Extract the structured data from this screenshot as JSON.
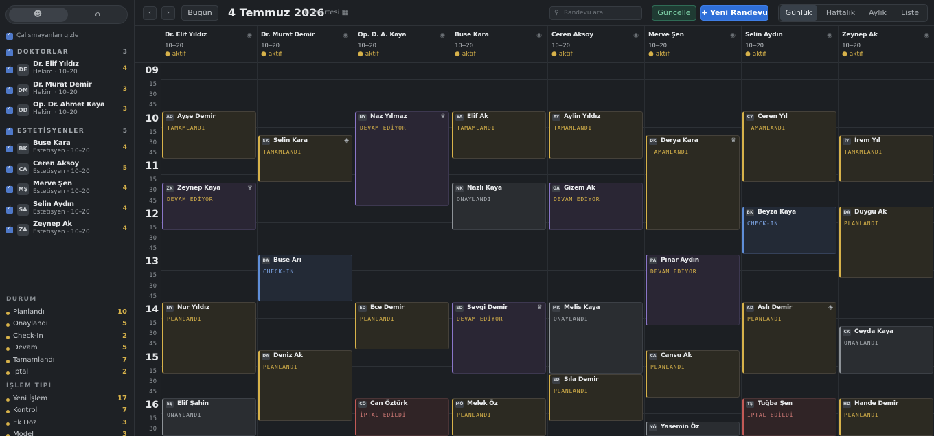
{
  "sidebar": {
    "hide_inactive": "Çalışmayanları gizle",
    "group_doctors": "DOKTORLAR",
    "group_doctors_count": "3",
    "doctors": [
      {
        "initials": "DE",
        "name": "Dr. Elif Yıldız",
        "role": "Hekim · 10–20",
        "count": "4"
      },
      {
        "initials": "DM",
        "name": "Dr. Murat Demir",
        "role": "Hekim · 10–20",
        "count": "3"
      },
      {
        "initials": "OD",
        "name": "Op. Dr. Ahmet Kaya",
        "role": "Hekim · 10–20",
        "count": "3"
      }
    ],
    "group_est": "ESTETİSYENLER",
    "group_est_count": "5",
    "estheticians": [
      {
        "initials": "BK",
        "name": "Buse Kara",
        "role": "Estetisyen · 10–20",
        "count": "4"
      },
      {
        "initials": "CA",
        "name": "Ceren Aksoy",
        "role": "Estetisyen · 10–20",
        "count": "5"
      },
      {
        "initials": "MŞ",
        "name": "Merve Şen",
        "role": "Estetisyen · 10–20",
        "count": "4"
      },
      {
        "initials": "SA",
        "name": "Selin Aydın",
        "role": "Estetisyen · 10–20",
        "count": "4"
      },
      {
        "initials": "ZA",
        "name": "Zeynep Ak",
        "role": "Estetisyen · 10–20",
        "count": "4"
      }
    ],
    "status_title": "DURUM",
    "statuses": [
      {
        "label": "Planlandı",
        "count": "10",
        "color": "#d7b24a"
      },
      {
        "label": "Onaylandı",
        "count": "5",
        "color": "#d7b24a"
      },
      {
        "label": "Check-In",
        "count": "2",
        "color": "#d7b24a"
      },
      {
        "label": "Devam",
        "count": "5",
        "color": "#d7b24a"
      },
      {
        "label": "Tamamlandı",
        "count": "7",
        "color": "#d7b24a"
      },
      {
        "label": "İptal",
        "count": "2",
        "color": "#d7b24a"
      }
    ],
    "type_title": "İŞLEM TİPİ",
    "types": [
      {
        "label": "Yeni İşlem",
        "count": "17",
        "color": "#d7b24a"
      },
      {
        "label": "Kontrol",
        "count": "7",
        "color": "#d7b24a"
      },
      {
        "label": "Ek Doz",
        "count": "3",
        "color": "#d7b24a"
      },
      {
        "label": "Model",
        "count": "3",
        "color": "#d7b24a"
      }
    ]
  },
  "topbar": {
    "prev": "‹",
    "next": "›",
    "today": "Bugün",
    "date": "4 Temmuz 2026",
    "day": "Cumartesi",
    "search_placeholder": "Randevu ara...",
    "refresh": "Güncelle",
    "new_appt": "+ Yeni Randevu",
    "views": [
      "Günlük",
      "Haftalık",
      "Aylık",
      "Liste"
    ]
  },
  "columns": [
    {
      "name": "Dr. Elif Yıldız",
      "hours": "10–20",
      "status": "● aktif"
    },
    {
      "name": "Dr. Murat Demir",
      "hours": "10–20",
      "status": "● aktif"
    },
    {
      "name": "Op. D. A. Kaya",
      "hours": "10–20",
      "status": "● aktif"
    },
    {
      "name": "Buse Kara",
      "hours": "10–20",
      "status": "● aktif"
    },
    {
      "name": "Ceren Aksoy",
      "hours": "10–20",
      "status": "● aktif"
    },
    {
      "name": "Merve Şen",
      "hours": "10–20",
      "status": "● aktif"
    },
    {
      "name": "Selin Aydın",
      "hours": "10–20",
      "status": "● aktif"
    },
    {
      "name": "Zeynep Ak",
      "hours": "10–20",
      "status": "● aktif"
    }
  ],
  "hours": [
    "09",
    "10",
    "11",
    "12",
    "13",
    "14",
    "15",
    "16"
  ],
  "minute_marks": [
    "15",
    "30",
    "45"
  ],
  "events": [
    {
      "col": 0,
      "start": "10:00",
      "end": "11:00",
      "ini": "AD",
      "name": "Ayşe Demir",
      "status": "TAMAMLANDI",
      "kind": "gold"
    },
    {
      "col": 0,
      "start": "11:30",
      "end": "12:30",
      "ini": "ZK",
      "name": "Zeynep Kaya",
      "status": "DEVAM EDİYOR",
      "kind": "pur",
      "icon": "♛"
    },
    {
      "col": 0,
      "start": "14:00",
      "end": "15:30",
      "ini": "NY",
      "name": "Nur Yıldız",
      "status": "PLANLANDI",
      "kind": "gold"
    },
    {
      "col": 0,
      "start": "16:00",
      "end": "17:00",
      "ini": "EŞ",
      "name": "Elif Şahin",
      "status": "ONAYLANDI",
      "kind": "gray"
    },
    {
      "col": 1,
      "start": "10:30",
      "end": "11:30",
      "ini": "SK",
      "name": "Selin Kara",
      "status": "TAMAMLANDI",
      "kind": "gold",
      "icon": "◈"
    },
    {
      "col": 1,
      "start": "13:00",
      "end": "14:00",
      "ini": "BA",
      "name": "Buse Arı",
      "status": "CHECK-IN",
      "kind": "blue"
    },
    {
      "col": 1,
      "start": "15:00",
      "end": "16:30",
      "ini": "DA",
      "name": "Deniz Ak",
      "status": "PLANLANDI",
      "kind": "gold"
    },
    {
      "col": 2,
      "start": "10:00",
      "end": "12:00",
      "ini": "NY",
      "name": "Naz Yılmaz",
      "status": "DEVAM EDİYOR",
      "kind": "pur",
      "icon": "♛"
    },
    {
      "col": 2,
      "start": "14:00",
      "end": "15:00",
      "ini": "ED",
      "name": "Ece Demir",
      "status": "PLANLANDI",
      "kind": "gold"
    },
    {
      "col": 2,
      "start": "16:00",
      "end": "17:00",
      "ini": "CÖ",
      "name": "Can Öztürk",
      "status": "İPTAL EDİLDİ",
      "kind": "red"
    },
    {
      "col": 3,
      "start": "10:00",
      "end": "11:00",
      "ini": "EA",
      "name": "Elif Ak",
      "status": "TAMAMLANDI",
      "kind": "gold"
    },
    {
      "col": 3,
      "start": "11:30",
      "end": "12:30",
      "ini": "NK",
      "name": "Nazlı Kaya",
      "status": "ONAYLANDI",
      "kind": "gray"
    },
    {
      "col": 3,
      "start": "14:00",
      "end": "15:30",
      "ini": "SD",
      "name": "Sevgi Demir",
      "status": "DEVAM EDİYOR",
      "kind": "pur",
      "icon": "♛"
    },
    {
      "col": 3,
      "start": "16:00",
      "end": "17:00",
      "ini": "MÖ",
      "name": "Melek Öz",
      "status": "PLANLANDI",
      "kind": "gold"
    },
    {
      "col": 4,
      "start": "10:00",
      "end": "11:00",
      "ini": "AY",
      "name": "Aylin Yıldız",
      "status": "TAMAMLANDI",
      "kind": "gold"
    },
    {
      "col": 4,
      "start": "11:30",
      "end": "12:30",
      "ini": "GA",
      "name": "Gizem Ak",
      "status": "DEVAM EDİYOR",
      "kind": "pur"
    },
    {
      "col": 4,
      "start": "14:00",
      "end": "15:30",
      "ini": "MK",
      "name": "Melis Kaya",
      "status": "ONAYLANDI",
      "kind": "gray"
    },
    {
      "col": 4,
      "start": "15:30",
      "end": "16:30",
      "ini": "SD",
      "name": "Sıla Demir",
      "status": "PLANLANDI",
      "kind": "gold"
    },
    {
      "col": 5,
      "start": "10:30",
      "end": "12:30",
      "ini": "DK",
      "name": "Derya Kara",
      "status": "TAMAMLANDI",
      "kind": "gold",
      "icon": "♛"
    },
    {
      "col": 5,
      "start": "13:00",
      "end": "14:30",
      "ini": "PA",
      "name": "Pınar Aydın",
      "status": "DEVAM EDİYOR",
      "kind": "pur"
    },
    {
      "col": 5,
      "start": "15:00",
      "end": "16:00",
      "ini": "CA",
      "name": "Cansu Ak",
      "status": "PLANLANDI",
      "kind": "gold"
    },
    {
      "col": 5,
      "start": "16:30",
      "end": "17:00",
      "ini": "YÖ",
      "name": "Yasemin Öz",
      "status": "",
      "kind": "gray"
    },
    {
      "col": 6,
      "start": "10:00",
      "end": "11:30",
      "ini": "CY",
      "name": "Ceren Yıl",
      "status": "TAMAMLANDI",
      "kind": "gold"
    },
    {
      "col": 6,
      "start": "12:00",
      "end": "13:00",
      "ini": "BK",
      "name": "Beyza Kaya",
      "status": "CHECK-IN",
      "kind": "blue"
    },
    {
      "col": 6,
      "start": "14:00",
      "end": "15:30",
      "ini": "AD",
      "name": "Aslı Demir",
      "status": "PLANLANDI",
      "kind": "gold",
      "icon": "◈"
    },
    {
      "col": 6,
      "start": "16:00",
      "end": "17:00",
      "ini": "TŞ",
      "name": "Tuğba Şen",
      "status": "İPTAL EDİLDİ",
      "kind": "red"
    },
    {
      "col": 7,
      "start": "10:30",
      "end": "11:30",
      "ini": "İY",
      "name": "İrem Yıl",
      "status": "TAMAMLANDI",
      "kind": "gold"
    },
    {
      "col": 7,
      "start": "12:00",
      "end": "13:30",
      "ini": "DA",
      "name": "Duygu Ak",
      "status": "PLANLANDI",
      "kind": "gold"
    },
    {
      "col": 7,
      "start": "14:30",
      "end": "15:30",
      "ini": "CK",
      "name": "Ceyda Kaya",
      "status": "ONAYLANDI",
      "kind": "gray"
    },
    {
      "col": 7,
      "start": "16:00",
      "end": "17:00",
      "ini": "HD",
      "name": "Hande Demir",
      "status": "PLANLANDI",
      "kind": "gold"
    }
  ]
}
